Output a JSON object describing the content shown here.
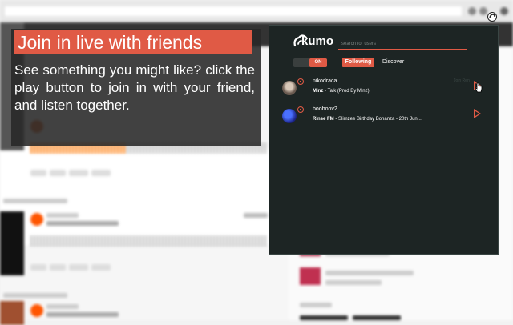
{
  "tutorial": {
    "title": "Join in live with friends",
    "body": "See something you might like? click the play button to join in with your friend, and listen together."
  },
  "popup": {
    "brand": "kumo",
    "search_placeholder": "search for users",
    "toggle_label": "ON",
    "tabs": [
      {
        "label": "Following",
        "active": true
      },
      {
        "label": "Discover",
        "active": false
      }
    ],
    "friends": [
      {
        "username": "nikodraca",
        "artist": "Minz",
        "title": "Talk (Prod By Minz)",
        "hover_label": "Join Ren",
        "avatar_color": "#8a7a70"
      },
      {
        "username": "booboov2",
        "artist": "Rinse FM",
        "title": "Slimzee Birthday Bonanza - 20th Jun...",
        "hover_label": "",
        "avatar_color": "#2b44c9"
      }
    ]
  },
  "colors": {
    "accent": "#e05a45",
    "popup_bg": "#1d2524"
  }
}
